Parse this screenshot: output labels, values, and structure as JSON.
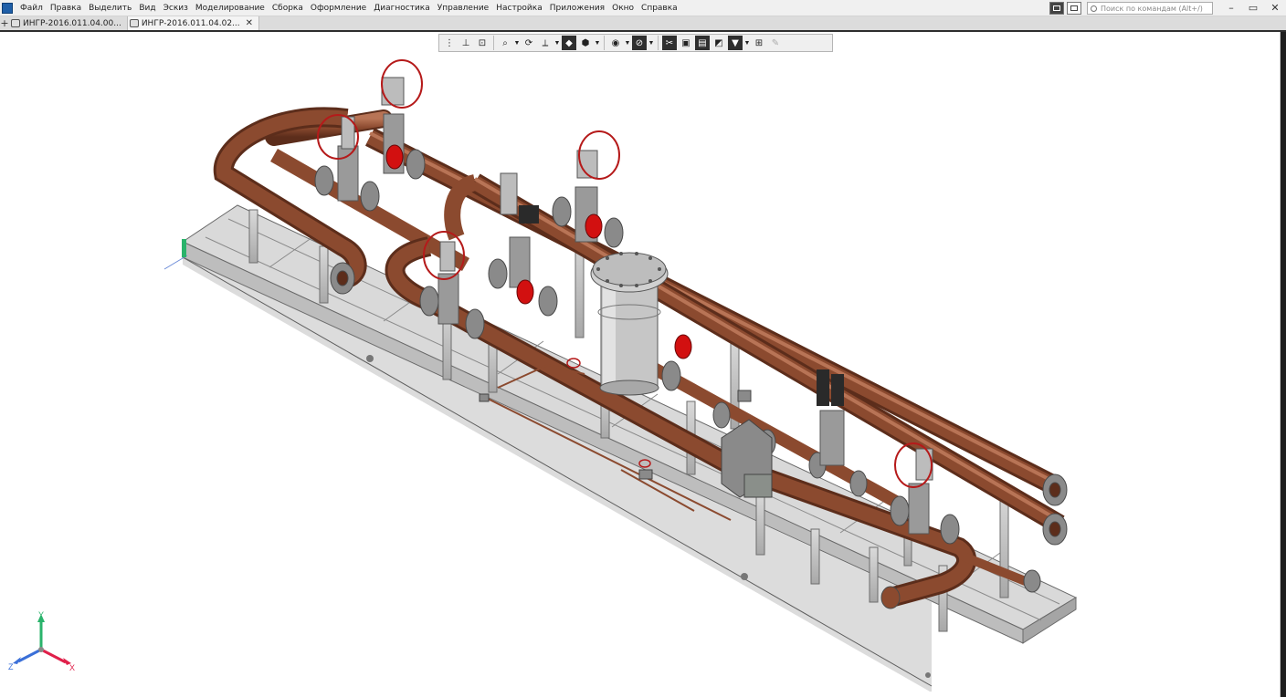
{
  "menu": {
    "items": [
      "Файл",
      "Правка",
      "Выделить",
      "Вид",
      "Эскиз",
      "Моделирование",
      "Сборка",
      "Оформление",
      "Диагностика",
      "Управление",
      "Настройка",
      "Приложения",
      "Окно",
      "Справка"
    ],
    "search_placeholder": "Поиск по командам (Alt+/)",
    "window_controls": [
      "–",
      "▭",
      "✕"
    ]
  },
  "tabs": [
    {
      "label": "ИНГР-2016.011.04.00...",
      "active": false
    },
    {
      "label": "ИНГР-2016.011.04.02...",
      "active": true,
      "close": "✕"
    }
  ],
  "axes": {
    "x": "X",
    "y": "Y",
    "z": "Z"
  },
  "colors": {
    "pipe": "#8b4a2f",
    "pipe_light": "#b06a48",
    "frame": "#c8c8c8",
    "valve_body": "#9a9a9a",
    "flange": "#7e7e7e",
    "handwheel": "#b51a1a",
    "red_disc": "#d21010",
    "axis_x": "#e0204a",
    "axis_y": "#2ab36b",
    "axis_z": "#3a6fd8"
  }
}
